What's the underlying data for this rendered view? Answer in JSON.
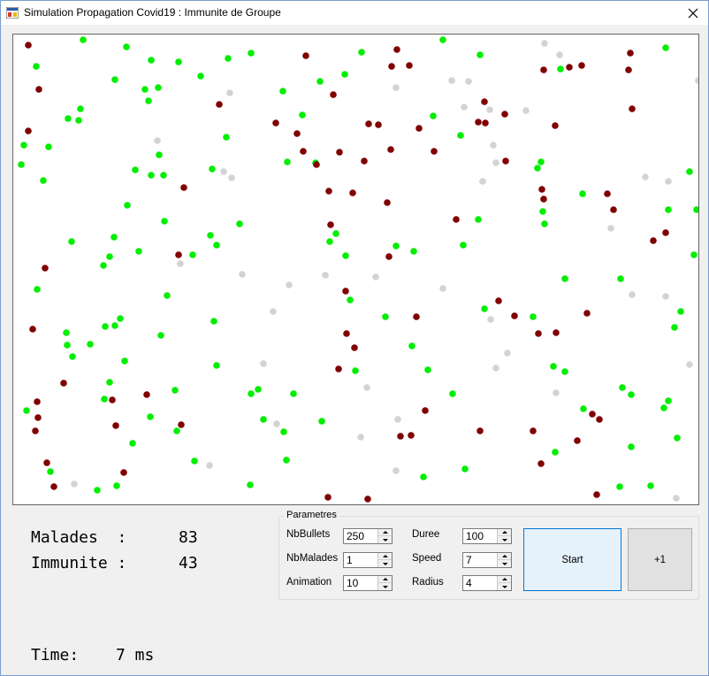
{
  "window": {
    "title": "Simulation Propagation Covid19 : Immunite de Groupe"
  },
  "stats": {
    "malades_label": "Malades  :",
    "malades_value": "83",
    "immunite_label": "Immunite :",
    "immunite_value": "43",
    "time_label": "Time:",
    "time_value": "7 ms"
  },
  "parameters": {
    "group_title": "Parametres",
    "nbbullets_label": "NbBullets",
    "nbbullets_value": "250",
    "nbmalades_label": "NbMalades",
    "nbmalades_value": "1",
    "animation_label": "Animation",
    "animation_value": "10",
    "duree_label": "Duree",
    "duree_value": "100",
    "speed_label": "Speed",
    "speed_value": "7",
    "radius_label": "Radius",
    "radius_value": "4"
  },
  "buttons": {
    "start_label": "Start",
    "plus_label": "+1"
  },
  "colors": {
    "healthy": "#00ee00",
    "sick": "#800000",
    "immune": "#d3d3d3"
  }
}
